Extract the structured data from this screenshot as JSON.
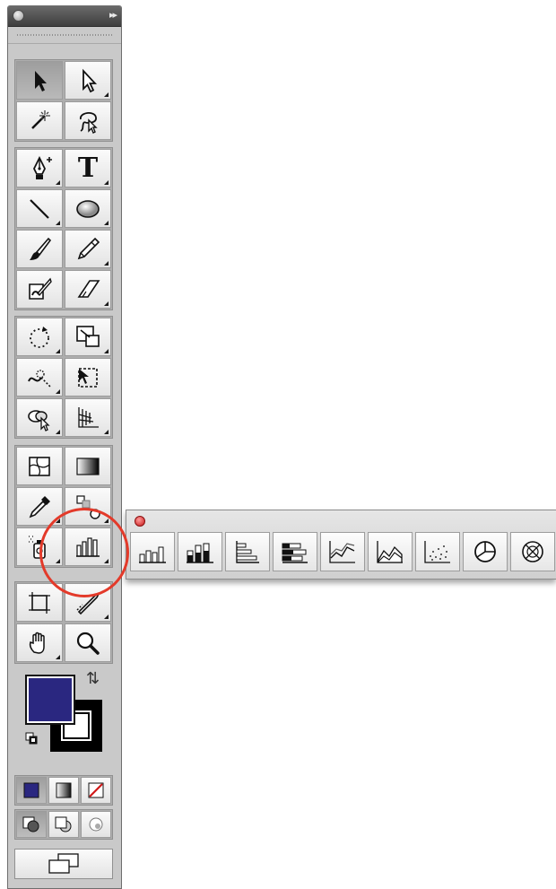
{
  "toolbox": {
    "expand_glyph": "▸▸",
    "groups": [
      {
        "rows": [
          [
            "selection-tool-icon",
            "direct-selection-tool-icon"
          ],
          [
            "magic-wand-tool-icon",
            "lasso-tool-icon"
          ]
        ]
      },
      {
        "rows": [
          [
            "pen-tool-icon",
            "type-tool-icon"
          ],
          [
            "line-segment-tool-icon",
            "ellipse-tool-icon"
          ],
          [
            "paintbrush-tool-icon",
            "pencil-tool-icon"
          ],
          [
            "blob-brush-tool-icon",
            "eraser-tool-icon"
          ]
        ]
      },
      {
        "rows": [
          [
            "rotate-tool-icon",
            "scale-tool-icon"
          ],
          [
            "warp-tool-icon",
            "free-transform-tool-icon"
          ],
          [
            "shape-builder-tool-icon",
            "perspective-grid-tool-icon"
          ]
        ]
      },
      {
        "rows": [
          [
            "mesh-tool-icon",
            "gradient-tool-icon"
          ],
          [
            "eyedropper-tool-icon",
            "blend-tool-icon"
          ],
          [
            "symbol-sprayer-tool-icon",
            "column-graph-tool-icon"
          ]
        ]
      },
      {
        "rows": [
          [
            "artboard-tool-icon",
            "slice-tool-icon"
          ],
          [
            "hand-tool-icon",
            "zoom-tool-icon"
          ]
        ]
      }
    ],
    "type_label": "T",
    "fill_color": "#2a2780",
    "stroke_color": "#000000",
    "color_modes": [
      "color-icon",
      "gradient-icon",
      "none-icon"
    ],
    "draw_modes": [
      "draw-normal-icon",
      "draw-behind-icon",
      "draw-inside-icon"
    ],
    "screen_mode": "screen-mode-icon"
  },
  "flyout": {
    "tools": [
      "column-graph-icon",
      "stacked-column-graph-icon",
      "bar-graph-icon",
      "stacked-bar-graph-icon",
      "line-graph-icon",
      "area-graph-icon",
      "scatter-graph-icon",
      "pie-graph-icon",
      "radar-graph-icon"
    ]
  },
  "annotation": {
    "highlight_color": "#e33a2a"
  }
}
